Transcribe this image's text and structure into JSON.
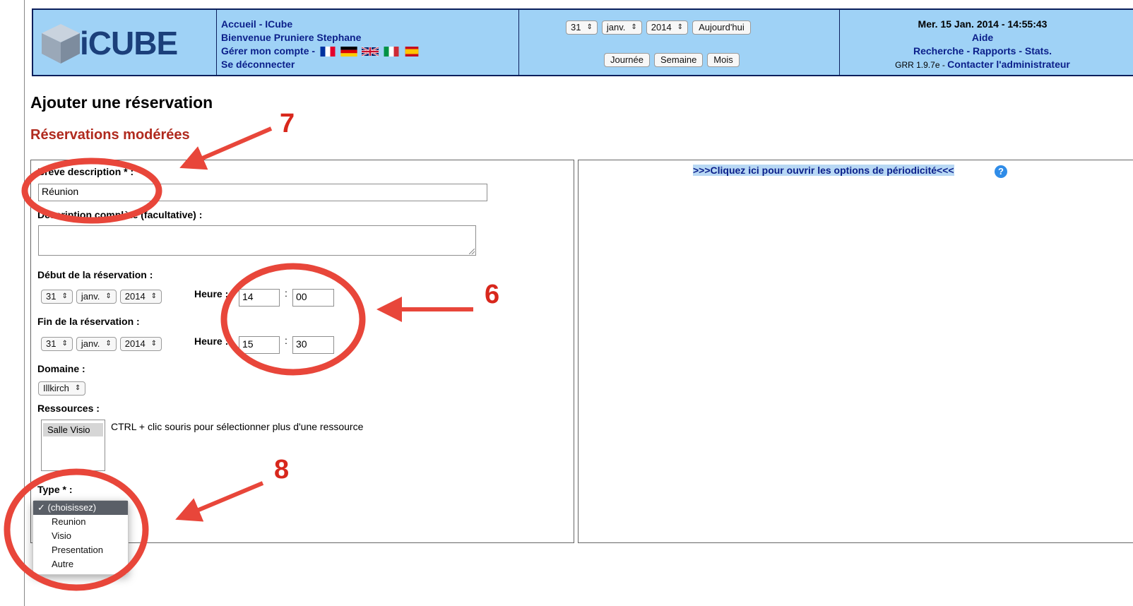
{
  "colors": {
    "header_bg": "#9fd2f6",
    "header_border": "#0b1f5c",
    "link": "#0b1f8a",
    "subtitle": "#b02a1e",
    "annotation": "#e8463a"
  },
  "header": {
    "logo_text": "iCUBE",
    "links": {
      "home": "Accueil - ICube",
      "welcome": "Bienvenue Pruniere Stephane",
      "manage_account": "Gérer mon compte -",
      "logout": "Se déconnecter"
    },
    "nav": {
      "day": "31",
      "month": "janv.",
      "year": "2014",
      "today_button": "Aujourd'hui",
      "day_view": "Journée",
      "week_view": "Semaine",
      "month_view": "Mois"
    },
    "info": {
      "datetime": "Mer. 15 Jan. 2014 - 14:55:43",
      "help": "Aide",
      "tools": "Recherche - Rapports - Stats.",
      "version": "GRR 1.9.7e -",
      "contact": "Contacter l'administrateur"
    }
  },
  "page": {
    "title": "Ajouter une réservation",
    "subtitle": "Réservations modérées"
  },
  "form": {
    "short_desc_label": "Brève description * :",
    "short_desc_value": "Réunion",
    "full_desc_label": "Description complète (facultative) :",
    "start_label": "Début de la réservation :",
    "start": {
      "day": "31",
      "month": "janv.",
      "year": "2014",
      "hour_label": "Heure :",
      "hour": "14",
      "minute": "00"
    },
    "end_label": "Fin de la réservation :",
    "end": {
      "day": "31",
      "month": "janv.",
      "year": "2014",
      "hour_label": "Heure :",
      "hour": "15",
      "minute": "30"
    },
    "time_sep": ":",
    "domain_label": "Domaine :",
    "domain_value": "Illkirch",
    "resources_label": "Ressources :",
    "resource_selected": "Salle Visio",
    "resources_hint": "CTRL + clic souris pour sélectionner plus d'une ressource",
    "type_label": "Type * :",
    "type_options": [
      "✓ (choisissez)",
      "Reunion",
      "Visio",
      "Presentation",
      "Autre"
    ]
  },
  "periodicity": {
    "link": ">>>Cliquez ici pour ouvrir les options de périodicité<<<",
    "help_icon": "question-circle-icon"
  },
  "annotations": {
    "n7": "7",
    "n6": "6",
    "n8": "8"
  }
}
